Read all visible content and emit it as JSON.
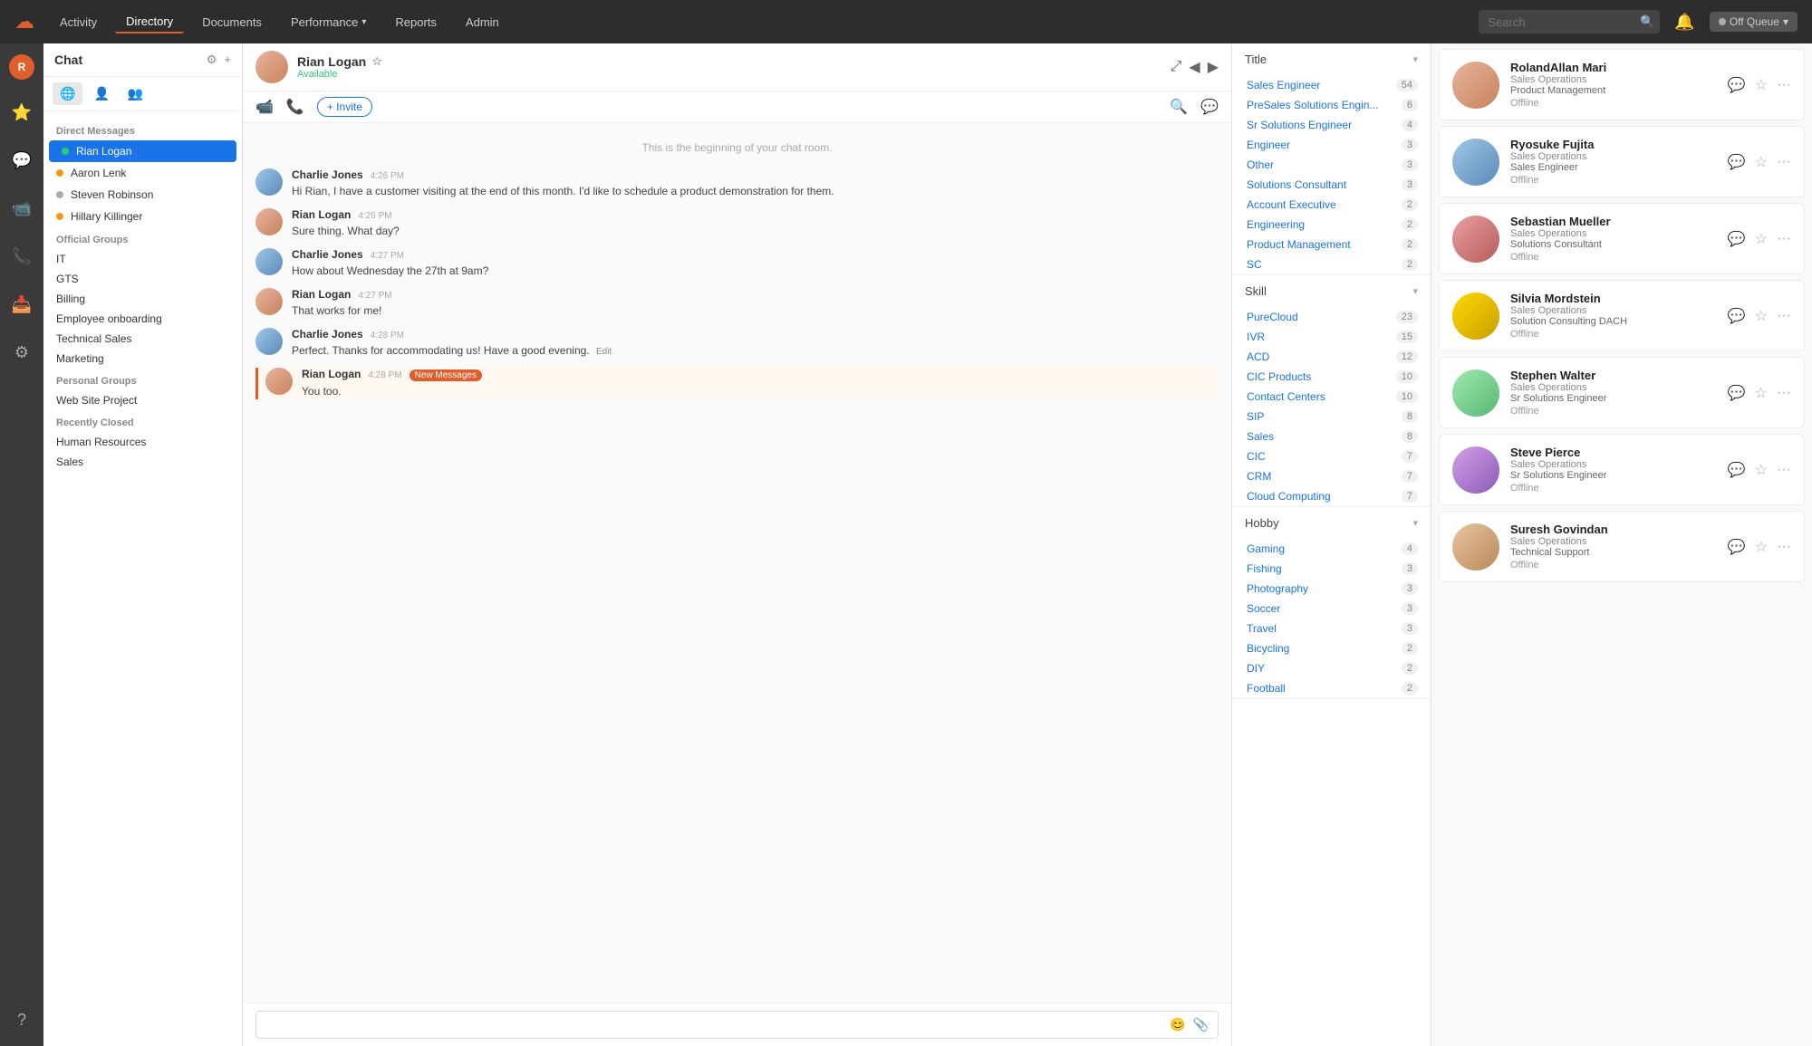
{
  "nav": {
    "logo": "☁",
    "items": [
      {
        "label": "Activity",
        "active": false
      },
      {
        "label": "Directory",
        "active": true
      },
      {
        "label": "Documents",
        "active": false
      },
      {
        "label": "Performance",
        "active": false,
        "hasChevron": true
      },
      {
        "label": "Reports",
        "active": false
      },
      {
        "label": "Admin",
        "active": false
      }
    ],
    "search_placeholder": "Search",
    "status_label": "Off Queue"
  },
  "chat_sidebar": {
    "title": "Chat",
    "direct_messages_label": "Direct Messages",
    "direct_messages": [
      {
        "name": "Rian Logan",
        "presence": "online",
        "active": true
      },
      {
        "name": "Aaron Lenk",
        "presence": "away",
        "active": false
      },
      {
        "name": "Steven Robinson",
        "presence": "offline",
        "active": false
      },
      {
        "name": "Hillary Killinger",
        "presence": "away",
        "active": false
      }
    ],
    "official_groups_label": "Official Groups",
    "official_groups": [
      "IT",
      "GTS",
      "Billing",
      "Employee onboarding",
      "Technical Sales",
      "Marketing"
    ],
    "personal_groups_label": "Personal Groups",
    "personal_groups": [
      "Web Site Project"
    ],
    "recently_closed_label": "Recently Closed",
    "recently_closed": [
      "Human Resources",
      "Sales"
    ]
  },
  "chat_main": {
    "contact_name": "Rian Logan",
    "contact_status": "Available",
    "invite_label": "+ Invite",
    "start_note": "This is the beginning of your chat room.",
    "messages": [
      {
        "id": 1,
        "author": "Charlie Jones",
        "time": "4:26 PM",
        "text": "Hi Rian,  I have a customer visiting at the end of this month.  I'd like to schedule a product demonstration for them.",
        "new_messages": false,
        "highlight": false
      },
      {
        "id": 2,
        "author": "Rian Logan",
        "time": "4:26 PM",
        "text": "Sure thing. What day?",
        "new_messages": false,
        "highlight": false
      },
      {
        "id": 3,
        "author": "Charlie Jones",
        "time": "4:27 PM",
        "text": "How about Wednesday the 27th at 9am?",
        "new_messages": false,
        "highlight": false
      },
      {
        "id": 4,
        "author": "Rian Logan",
        "time": "4:27 PM",
        "text": "That works for me!",
        "new_messages": false,
        "highlight": false
      },
      {
        "id": 5,
        "author": "Charlie Jones",
        "time": "4:28 PM",
        "text": "Perfect.  Thanks for accommodating us!  Have a good evening.",
        "new_messages": false,
        "highlight": false,
        "has_edit": true
      },
      {
        "id": 6,
        "author": "Rian Logan",
        "time": "4:28 PM",
        "text": "You too.",
        "new_messages": true,
        "new_messages_label": "New Messages",
        "highlight": true
      }
    ]
  },
  "filters": {
    "title_section": {
      "label": "Title",
      "items": [
        {
          "name": "Sales Engineer",
          "count": 54
        },
        {
          "name": "PreSales Solutions Engin...",
          "count": 6
        },
        {
          "name": "Sr Solutions Engineer",
          "count": 4
        },
        {
          "name": "Engineer",
          "count": 3
        },
        {
          "name": "Other",
          "count": 3
        },
        {
          "name": "Solutions Consultant",
          "count": 3
        },
        {
          "name": "Account Executive",
          "count": 2
        },
        {
          "name": "Engineering",
          "count": 2
        },
        {
          "name": "Product Management",
          "count": 2
        },
        {
          "name": "SC",
          "count": 2
        }
      ]
    },
    "skill_section": {
      "label": "Skill",
      "items": [
        {
          "name": "PureCloud",
          "count": 23
        },
        {
          "name": "IVR",
          "count": 15
        },
        {
          "name": "ACD",
          "count": 12
        },
        {
          "name": "CIC Products",
          "count": 10
        },
        {
          "name": "Contact Centers",
          "count": 10
        },
        {
          "name": "SIP",
          "count": 8
        },
        {
          "name": "Sales",
          "count": 8
        },
        {
          "name": "CIC",
          "count": 7
        },
        {
          "name": "CRM",
          "count": 7
        },
        {
          "name": "Cloud Computing",
          "count": 7
        }
      ]
    },
    "hobby_section": {
      "label": "Hobby",
      "items": [
        {
          "name": "Gaming",
          "count": 4
        },
        {
          "name": "Fishing",
          "count": 3
        },
        {
          "name": "Photography",
          "count": 3
        },
        {
          "name": "Soccer",
          "count": 3
        },
        {
          "name": "Travel",
          "count": 3
        },
        {
          "name": "Bicycling",
          "count": 2
        },
        {
          "name": "DIY",
          "count": 2
        },
        {
          "name": "Football",
          "count": 2
        }
      ]
    }
  },
  "directory": {
    "people": [
      {
        "name": "RolandAllan Mari",
        "dept": "Sales Operations",
        "title": "Product Management",
        "status": "Offline",
        "av_class": "av-1"
      },
      {
        "name": "Ryosuke Fujita",
        "dept": "Sales Operations",
        "title": "Sales Engineer",
        "status": "Offline",
        "av_class": "av-2"
      },
      {
        "name": "Sebastian Mueller",
        "dept": "Sales Operations",
        "title": "Solutions Consultant",
        "status": "Offline",
        "av_class": "av-3"
      },
      {
        "name": "Silvia Mordstein",
        "dept": "Sales Operations",
        "title": "Solution Consulting DACH",
        "status": "Offline",
        "av_class": "av-4"
      },
      {
        "name": "Stephen Walter",
        "dept": "Sales Operations",
        "title": "Sr Solutions Engineer",
        "status": "Offline",
        "av_class": "av-5"
      },
      {
        "name": "Steve Pierce",
        "dept": "Sales Operations",
        "title": "Sr Solutions Engineer",
        "status": "Offline",
        "av_class": "av-6"
      },
      {
        "name": "Suresh Govindan",
        "dept": "Sales Operations",
        "title": "Technical Support",
        "status": "Offline",
        "av_class": "av-7"
      }
    ]
  }
}
